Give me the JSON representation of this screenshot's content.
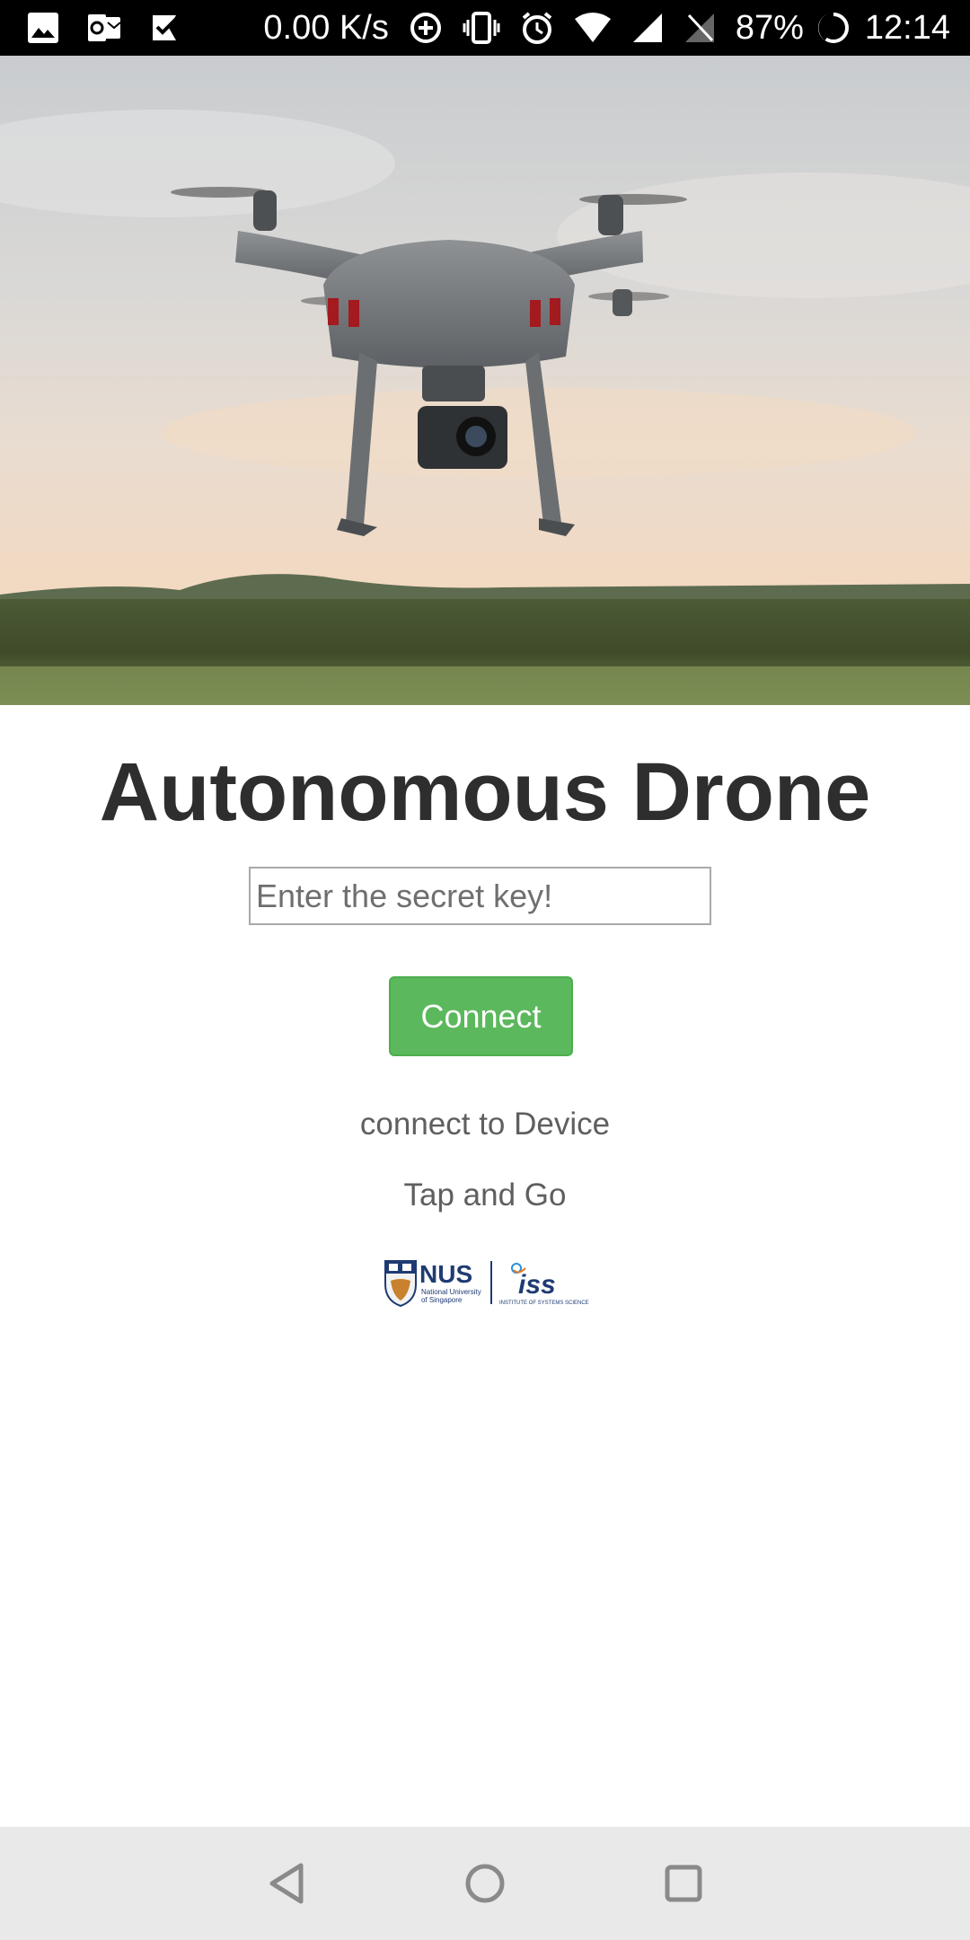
{
  "status_bar": {
    "net_speed": "0.00 K/s",
    "battery_percent": "87%",
    "time": "12:14",
    "icons_left": [
      "gallery-icon",
      "outlook-icon",
      "check-app-icon"
    ],
    "icons_right": [
      "data-saver-icon",
      "vibrate-icon",
      "alarm-icon",
      "wifi-icon",
      "signal-icon",
      "no-sim-icon",
      "battery-icon"
    ]
  },
  "hero": {
    "image": "drone-photo"
  },
  "main": {
    "title": "Autonomous Drone",
    "key_placeholder": "Enter the secret key!",
    "connect_label": "Connect",
    "status_text": "connect to Device",
    "hint_text": "Tap and Go"
  },
  "logo": {
    "nus_text": "NUS",
    "nus_subtext_1": "National University",
    "nus_subtext_2": "of Singapore",
    "iss_text": "iss",
    "iss_subtext": "INSTITUTE OF SYSTEMS SCIENCE"
  },
  "nav_bar": {
    "buttons": [
      "back-icon",
      "home-icon",
      "recents-icon"
    ]
  },
  "colors": {
    "accent_button": "#5cb85c",
    "title_text": "#2e2e2e",
    "status_bar_bg": "#000000",
    "nav_bar_bg": "#e9e9e9"
  }
}
